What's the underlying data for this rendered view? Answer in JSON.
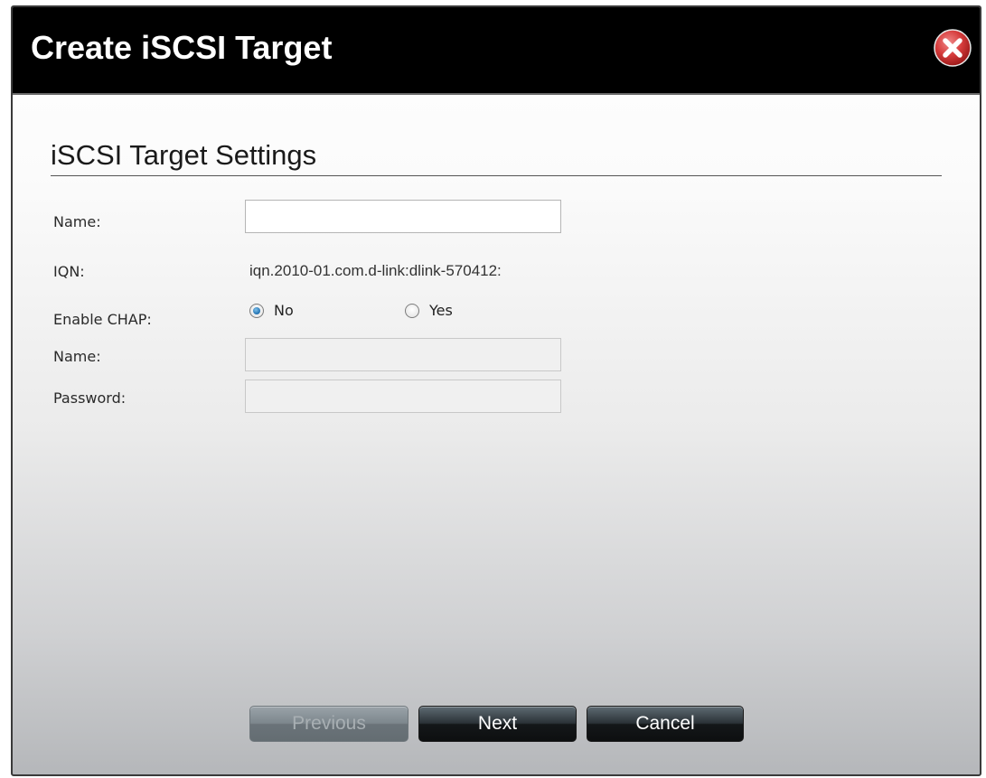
{
  "dialog": {
    "title": "Create iSCSI Target",
    "close_icon": "close-icon"
  },
  "section": {
    "title": "iSCSI Target Settings"
  },
  "form": {
    "name_label": "Name:",
    "name_value": "",
    "iqn_label": "IQN:",
    "iqn_value": "iqn.2010-01.com.d-link:dlink-570412:",
    "chap_label": "Enable CHAP:",
    "chap_options": [
      {
        "label": "No",
        "checked": true
      },
      {
        "label": "Yes",
        "checked": false
      }
    ],
    "chap_name_label": "Name:",
    "chap_name_value": "",
    "password_label": "Password:",
    "password_value": ""
  },
  "buttons": {
    "previous": "Previous",
    "next": "Next",
    "cancel": "Cancel"
  },
  "colors": {
    "titlebar": "#000000",
    "close_red": "#c62828",
    "radio_selected": "#1e6fb0"
  }
}
